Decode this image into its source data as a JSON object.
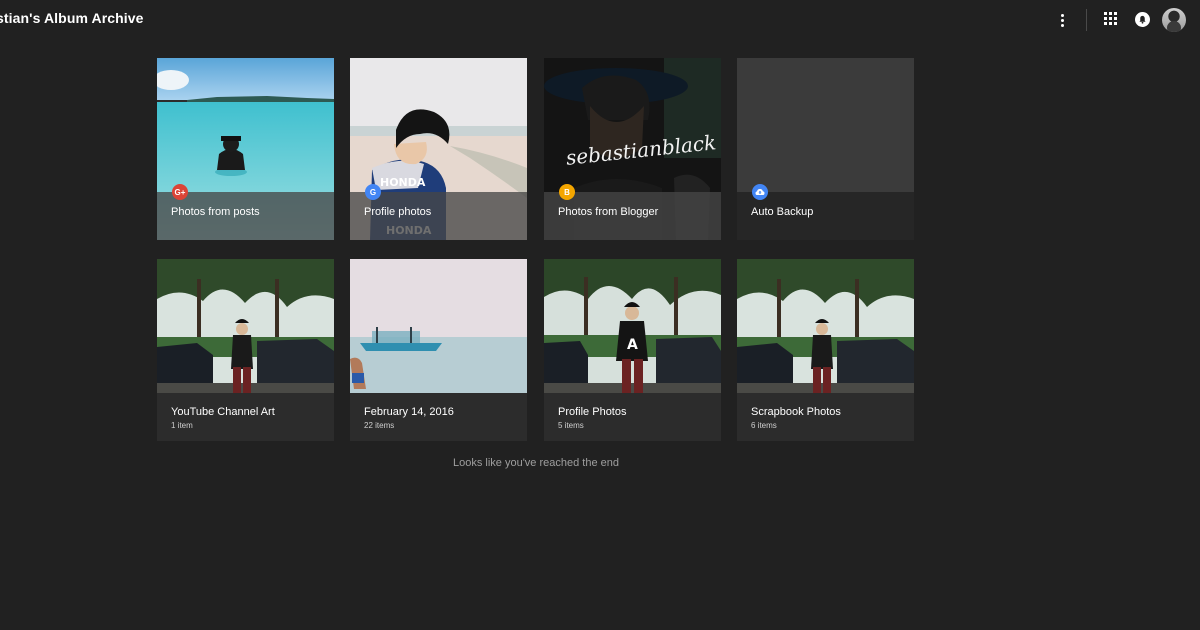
{
  "header": {
    "title": "stian's Album Archive",
    "icons": [
      "more-vert-icon",
      "apps-grid-icon",
      "notifications-icon",
      "account-avatar"
    ]
  },
  "albums_row1": [
    {
      "title": "Photos from posts",
      "badge": "G+",
      "badge_color": "#db4437",
      "badge_icon": "google-plus-icon"
    },
    {
      "title": "Profile photos",
      "badge": "G",
      "badge_color": "#4285f4",
      "badge_icon": "google-icon"
    },
    {
      "title": "Photos from Blogger",
      "badge": "B",
      "badge_color": "#f4a600",
      "badge_icon": "blogger-icon"
    },
    {
      "title": "Auto Backup",
      "badge": "",
      "badge_color": "#4285f4",
      "badge_icon": "cloud-upload-icon"
    }
  ],
  "albums_row2": [
    {
      "title": "YouTube Channel Art",
      "count": "1 item"
    },
    {
      "title": "February 14, 2016",
      "count": "22 items"
    },
    {
      "title": "Profile Photos",
      "count": "5 items"
    },
    {
      "title": "Scrapbook Photos",
      "count": "6 items"
    }
  ],
  "watermark_text": "sebastianblack",
  "footer": {
    "message": "Looks like you've reached the end"
  },
  "colors": {
    "background": "#212121",
    "card": "#2c2c2c"
  }
}
